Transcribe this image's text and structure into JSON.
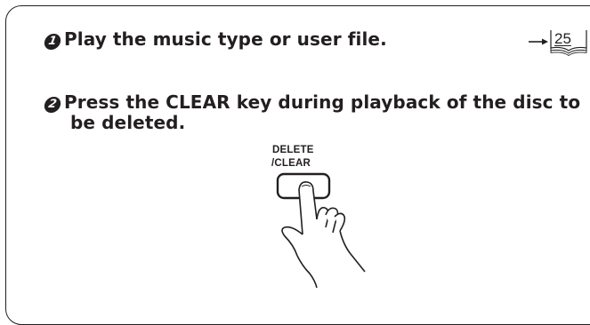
{
  "steps": [
    {
      "number": "1",
      "text": "Play the music type or user file."
    },
    {
      "number": "2",
      "text_line1": "Press the CLEAR key during playback of the disc to",
      "text_line2": "be deleted."
    }
  ],
  "page_reference": {
    "page": "25",
    "arrow": "arrow-right-icon",
    "book": "book-icon"
  },
  "key": {
    "label_top": "DELETE",
    "label_bottom": "/CLEAR",
    "icon": "hand-pressing-key-icon"
  }
}
